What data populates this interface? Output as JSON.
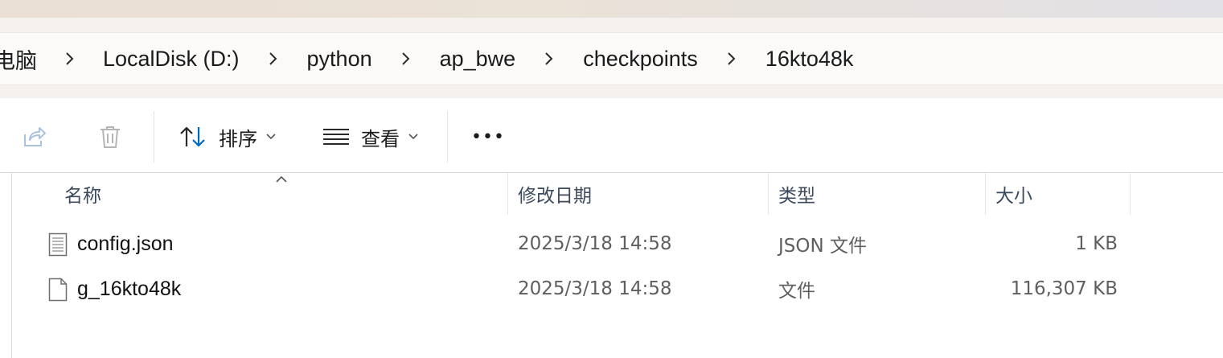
{
  "breadcrumb": {
    "items": [
      "电脑",
      "LocalDisk (D:)",
      "python",
      "ap_bwe",
      "checkpoints",
      "16kto48k"
    ]
  },
  "toolbar": {
    "share_icon": "share-icon",
    "delete_icon": "trash-icon",
    "sort_label": "排序",
    "view_label": "查看",
    "more_label": "•••"
  },
  "columns": {
    "name": "名称",
    "modified": "修改日期",
    "type": "类型",
    "size": "大小"
  },
  "files": [
    {
      "name": "config.json",
      "modified": "2025/3/18 14:58",
      "type": "JSON 文件",
      "size": "1 KB",
      "icon": "text-file-icon"
    },
    {
      "name": "g_16kto48k",
      "modified": "2025/3/18 14:58",
      "type": "文件",
      "size": "116,307 KB",
      "icon": "blank-file-icon"
    }
  ],
  "colors": {
    "accent": "#0067c0",
    "header_text": "#3c4a5e",
    "secondary_text": "#5f5f5f"
  }
}
